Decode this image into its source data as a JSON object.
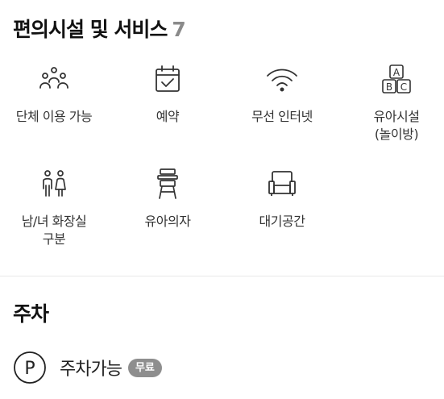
{
  "amenities_section": {
    "title": "편의시설 및 서비스",
    "count": "7",
    "items": [
      {
        "label": "단체 이용 가능",
        "icon": "group-icon"
      },
      {
        "label": "예약",
        "icon": "calendar-check-icon"
      },
      {
        "label": "무선 인터넷",
        "icon": "wifi-icon"
      },
      {
        "label": "유아시설\n(놀이방)",
        "icon": "abc-blocks-icon"
      },
      {
        "label": "남/녀 화장실\n구분",
        "icon": "restroom-icon"
      },
      {
        "label": "유아의자",
        "icon": "high-chair-icon"
      },
      {
        "label": "대기공간",
        "icon": "armchair-icon"
      }
    ]
  },
  "parking_section": {
    "title": "주차",
    "item_label": "주차가능",
    "badge": "무료",
    "icon": "parking-icon"
  },
  "colors": {
    "icon_stroke": "#333333",
    "count_gray": "#8a8a8a",
    "badge_bg": "#8e8e8e"
  }
}
